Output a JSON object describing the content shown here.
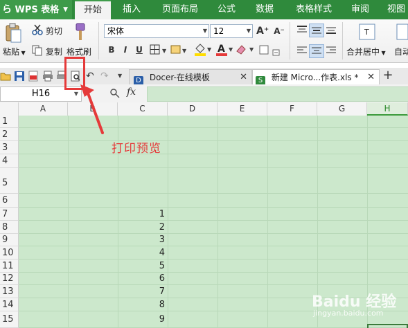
{
  "app": {
    "logo_label": "WPS 表格"
  },
  "menu": {
    "tabs": [
      {
        "label": "开始",
        "active": true
      },
      {
        "label": "插入",
        "active": false
      },
      {
        "label": "页面布局",
        "active": false
      },
      {
        "label": "公式",
        "active": false
      },
      {
        "label": "数据",
        "active": false
      },
      {
        "label": "表格样式",
        "active": false
      },
      {
        "label": "审阅",
        "active": false
      },
      {
        "label": "视图",
        "active": false
      }
    ]
  },
  "ribbon": {
    "paste_label": "粘贴",
    "cut_label": "剪切",
    "copy_label": "复制",
    "format_painter_label": "格式刷",
    "font_name": "宋体",
    "font_size": "12",
    "bold": "B",
    "italic": "I",
    "underline": "U",
    "merge_center_label": "合并居中",
    "auto_wrap_label": "自动"
  },
  "doc_tabs": [
    {
      "label": "Docer-在线模板",
      "active": false
    },
    {
      "label": "新建 Micro...作表.xls *",
      "active": true
    }
  ],
  "formula_bar": {
    "name_box": "H16",
    "fx_label": "fx",
    "value": ""
  },
  "sheet": {
    "columns": [
      "A",
      "B",
      "C",
      "D",
      "E",
      "F",
      "G",
      "H"
    ],
    "selected_column": "H",
    "rows": [
      "1",
      "2",
      "3",
      "4",
      "5",
      "6",
      "7",
      "8",
      "9",
      "10",
      "11",
      "12",
      "13",
      "14",
      "15"
    ],
    "column_c_values": [
      "1",
      "2",
      "3",
      "4",
      "5",
      "6",
      "7",
      "8",
      "9"
    ],
    "column_c_start_row": "7"
  },
  "annotation": {
    "label": "打印预览",
    "color": "#e53a3a"
  },
  "watermark": {
    "text": "Baidu 经验",
    "sub": "jingyan.baidu.com"
  },
  "colors": {
    "accent": "#2f8a3c",
    "grid_bg": "#cce8cc"
  }
}
